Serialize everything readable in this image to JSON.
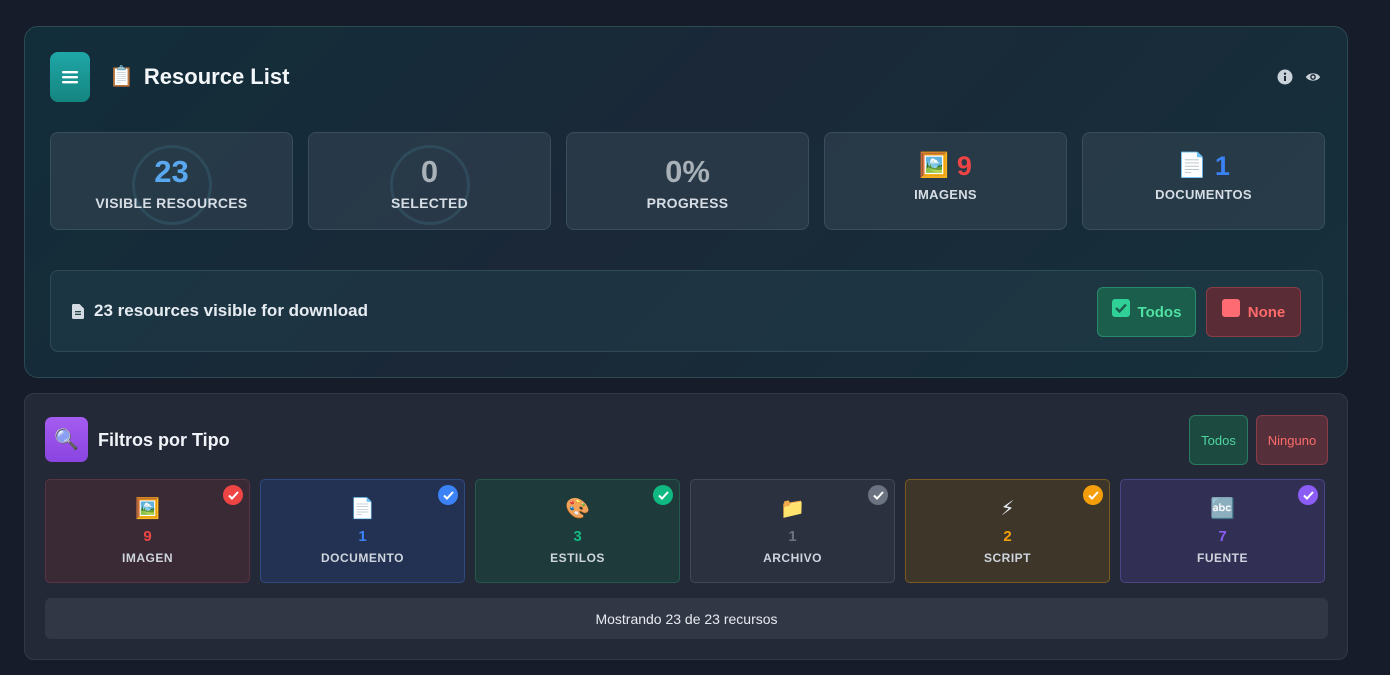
{
  "header": {
    "title_emoji": "📋",
    "title": "Resource List",
    "icons": [
      "info-icon",
      "eye-icon"
    ],
    "accent": "#1fa7a8"
  },
  "stats": [
    {
      "value": "23",
      "label": "VISIBLE RESOURCES",
      "color": "#5aa9f0"
    },
    {
      "value": "0",
      "label": "SELECTED",
      "color": "#a8b0b8"
    },
    {
      "value": "0%",
      "label": "PROGRESS",
      "color": "#a8b0b8"
    },
    {
      "emoji": "🖼️",
      "value": "9",
      "label": "IMAGENS",
      "color": "#ef4444"
    },
    {
      "emoji": "📄",
      "value": "1",
      "label": "DOCUMENTOS",
      "color": "#3b82f6"
    }
  ],
  "download_bar": {
    "text": "23 resources visible for download",
    "btn_all": "Todos",
    "btn_none": "None"
  },
  "filters": {
    "icon": "🔍",
    "title": "Filtros por Tipo",
    "btn_all": "Todos",
    "btn_none": "Ninguno",
    "types": [
      {
        "emoji": "🖼️",
        "count": "9",
        "label": "IMAGEN",
        "color": "#ef4444"
      },
      {
        "emoji": "📄",
        "count": "1",
        "label": "DOCUMENTO",
        "color": "#3b82f6"
      },
      {
        "emoji": "🎨",
        "count": "3",
        "label": "ESTILOS",
        "color": "#10b981"
      },
      {
        "emoji": "📁",
        "count": "1",
        "label": "ARCHIVO",
        "color": "#6b7280"
      },
      {
        "emoji": "⚡",
        "count": "2",
        "label": "SCRIPT",
        "color": "#f59e0b"
      },
      {
        "emoji": "🔤",
        "count": "7",
        "label": "FUENTE",
        "color": "#8b5cf6"
      }
    ],
    "showing": "Mostrando 23 de 23 recursos"
  }
}
